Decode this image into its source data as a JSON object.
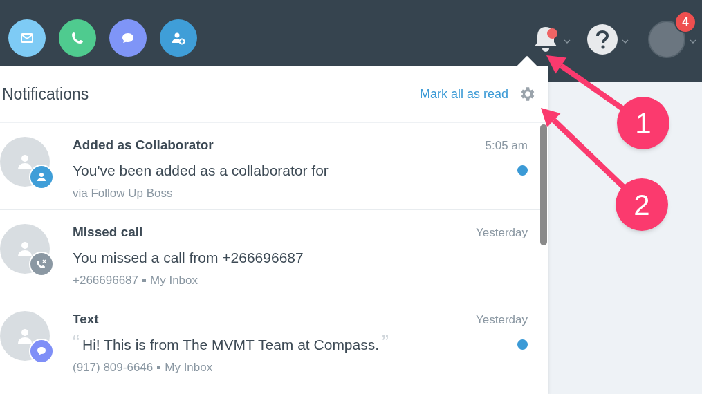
{
  "toolbar": {
    "apps": [
      {
        "kind": "mail",
        "color": "#7ecbf5"
      },
      {
        "kind": "phone",
        "color": "#4fcb8f"
      },
      {
        "kind": "chat",
        "color": "#7f95f7"
      },
      {
        "kind": "add-person",
        "color": "#3f9ed8"
      }
    ],
    "bell": {
      "has_unread": true
    },
    "profile": {
      "badge": "4"
    }
  },
  "notifications": {
    "title": "Notifications",
    "mark_all": "Mark all as read",
    "items": [
      {
        "kind": "collaborator",
        "title": "Added as Collaborator",
        "time": "5:05 am",
        "message": "You've been added as a collaborator for",
        "meta": [
          "via Follow Up Boss"
        ],
        "unread": true
      },
      {
        "kind": "call",
        "title": "Missed call",
        "time": "Yesterday",
        "message": "You missed a call from +266696687",
        "meta": [
          "+266696687",
          "My Inbox"
        ],
        "unread": false
      },
      {
        "kind": "text",
        "title": "Text",
        "time": "Yesterday",
        "open_quote": "“",
        "message": "Hi! This is from The MVMT Team at Compass.",
        "close_quote": "”",
        "meta": [
          "(917) 809-6646",
          "My Inbox"
        ],
        "unread": true
      }
    ]
  },
  "annotations": [
    {
      "label": "1"
    },
    {
      "label": "2"
    }
  ]
}
